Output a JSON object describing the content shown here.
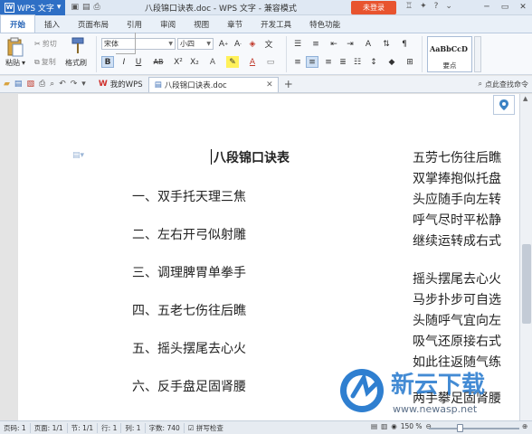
{
  "title_bar": {
    "app_name": "WPS 文字",
    "document_title": "八段锦口诀表.doc - WPS 文字 - 兼容模式",
    "login_label": "未登录"
  },
  "ribbon_tabs": [
    "开始",
    "插入",
    "页面布局",
    "引用",
    "审阅",
    "视图",
    "章节",
    "开发工具",
    "特色功能"
  ],
  "ribbon": {
    "paste_label": "粘贴",
    "cut_label": "剪切",
    "copy_label": "复制",
    "format_painter_label": "格式刷",
    "font_name": "宋体",
    "font_size": "小四",
    "style_sample": "AaBbCcD",
    "style_name": "要点"
  },
  "toolbar2": {
    "tabs": [
      {
        "label": "我的WPS"
      },
      {
        "label": "八段锦口诀表.doc"
      }
    ],
    "search_label": "点此查找命令"
  },
  "document": {
    "title": "八段锦口诀表",
    "left_items": [
      "一、双手托天理三焦",
      "二、左右开弓似射雕",
      "三、调理脾胃单拳手",
      "四、五老七伤往后瞧",
      "五、摇头摆尾去心火",
      "六、反手盘足固肾腰"
    ],
    "right_lines": [
      "五劳七伤往后瞧",
      "双掌捧抱似托盘",
      "头应随手向左转",
      "呼气尽时平松静",
      "继续运转成右式",
      "摇头摆尾去心火",
      "马步扑步可自选",
      "头随呼气宜向左",
      "吸气还原接右式",
      "如此往返随气练",
      "两手攀足固肾腰"
    ]
  },
  "status_bar": {
    "page": "页码: 1",
    "pages": "页面: 1/1",
    "section": "节: 1/1",
    "row": "行: 1",
    "col": "列: 1",
    "words": "字数: 740",
    "spell": "拼写检查",
    "zoom": "150 %"
  },
  "watermark": {
    "brand": "新云下载",
    "url": "www.newasp.net"
  },
  "colors": {
    "accent": "#2e6fc5",
    "login": "#e8542f"
  }
}
